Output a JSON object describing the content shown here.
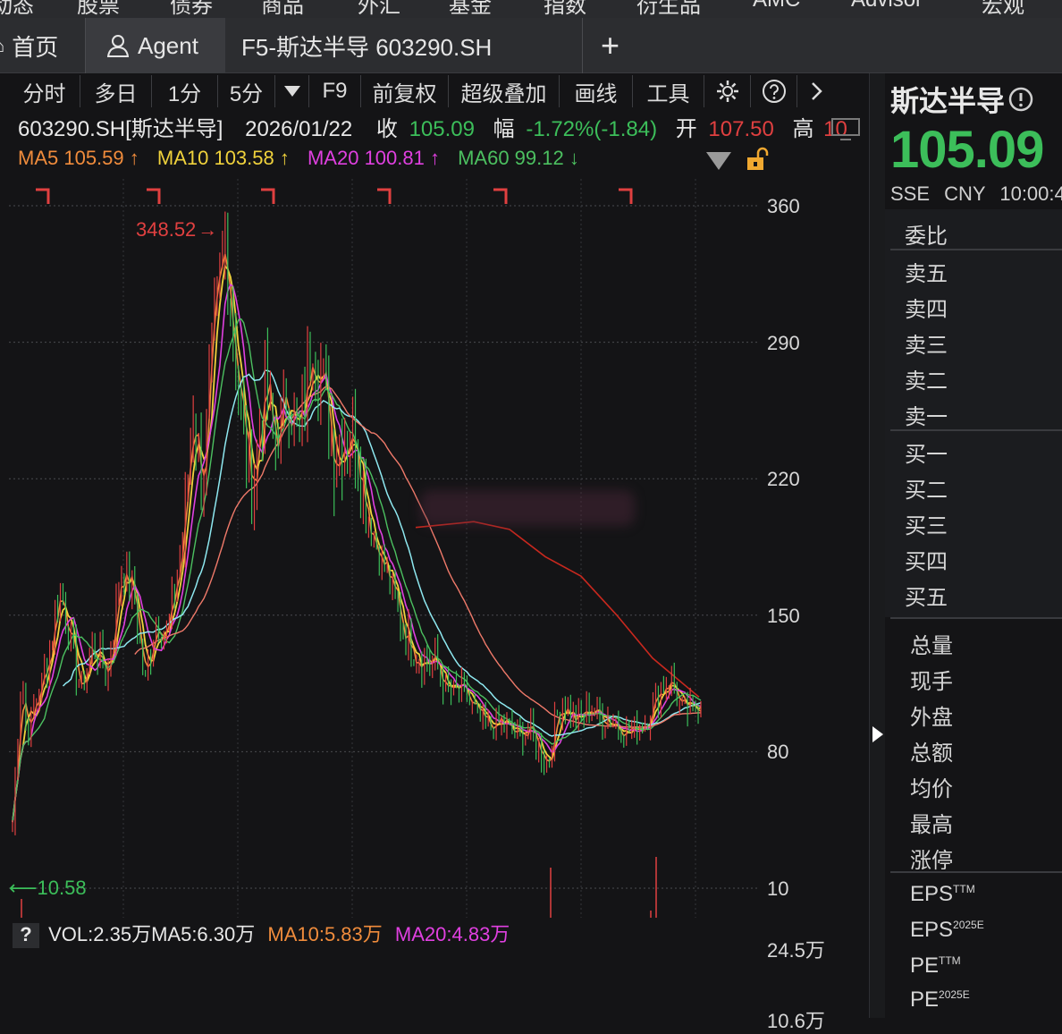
{
  "menu": [
    "动态",
    "股票",
    "债券",
    "商品",
    "外汇",
    "基金",
    "指数",
    "衍生品",
    "AMC",
    "Advisor",
    "宏观"
  ],
  "tabs": {
    "home": "首页",
    "agent": "Agent",
    "stock": "F5-斯达半导 603290.SH",
    "add": "+"
  },
  "toolbar": {
    "items": [
      "分时",
      "多日",
      "1分",
      "5分",
      "F9",
      "前复权",
      "超级叠加",
      "画线",
      "工具"
    ]
  },
  "quote_line": {
    "code_name": "603290.SH[斯达半导]",
    "date": "2026/01/22",
    "close_label": "收",
    "close_value": "105.09",
    "change_label": "幅",
    "change_value": "-1.72%(-1.84)",
    "open_label": "开",
    "open_value": "107.50",
    "high_label": "高",
    "high_value": "10"
  },
  "ma_line": {
    "ma5": "MA5 105.59 ↑",
    "ma10": "MA10 103.58 ↑",
    "ma20": "MA20 100.81 ↑",
    "ma60": "MA60 99.12 ↓"
  },
  "colors": {
    "ma5": "#f08c3c",
    "ma10": "#f0d23c",
    "ma20": "#e040e0",
    "ma60": "#4cc060",
    "up": "#e04040",
    "down": "#3cbe5a",
    "cyan": "#8ee8f0",
    "salmon": "#f07a6a"
  },
  "axis": {
    "price_ticks": [
      "360",
      "290",
      "220",
      "150",
      "80",
      "10"
    ],
    "vol_ticks": [
      "24.5万",
      "10.6万"
    ]
  },
  "annotations": {
    "high": "348.52",
    "low": "10.58"
  },
  "volume_line": {
    "q": "?",
    "vol": "VOL:2.35万",
    "ma5": "MA5:6.30万",
    "ma10": "MA10:5.83万",
    "ma20": "MA20:4.83万"
  },
  "right_panel": {
    "name": "斯达半导",
    "price": "105.09",
    "exchange": "SSE",
    "currency": "CNY",
    "time": "10:00:4",
    "order_book": [
      "委比",
      "卖五",
      "卖四",
      "卖三",
      "卖二",
      "卖一",
      "买一",
      "买二",
      "买三",
      "买四",
      "买五"
    ],
    "stats": [
      "总量",
      "现手",
      "外盘",
      "总额",
      "均价",
      "最高",
      "涨停"
    ],
    "eps_ttm": "EPS",
    "eps_ttm_sup": "TTM",
    "eps_2025": "EPS",
    "eps_2025_sup": "2025E",
    "pe_ttm": "PE",
    "pe_ttm_sup": "TTM",
    "pe_2025": "PE",
    "pe_2025_sup": "2025E"
  }
}
